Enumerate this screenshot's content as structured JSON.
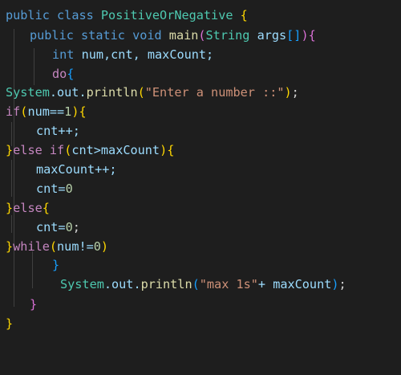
{
  "code": {
    "l1": {
      "kw_public": "public",
      "kw_class": "class",
      "class_name": "PositiveOrNegative",
      "brace": "{"
    },
    "l2": {
      "kw_public": "public",
      "kw_static": "static",
      "kw_void": "void",
      "method": "main",
      "paren_open": "(",
      "type": "String",
      "param": "args",
      "brackets": "[]",
      "paren_close": ")",
      "brace": "{"
    },
    "l3": {
      "kw_int": "int",
      "decl": "num,cnt, maxCount;"
    },
    "l4": {
      "kw_do": "do",
      "brace": "{"
    },
    "l5": {
      "obj": "System",
      "field": ".out.",
      "method": "println",
      "paren_open": "(",
      "str": "\"Enter a number ::\"",
      "paren_close": ")",
      "semi": ";"
    },
    "l6": {
      "kw_if": "if",
      "paren_open": "(",
      "cond": "num==",
      "num": "1",
      "paren_close": ")",
      "brace": "{"
    },
    "l7": {
      "stmt": "cnt++;"
    },
    "l8": {
      "brace_close": "}",
      "kw_else": "else",
      "kw_if": "if",
      "paren_open": "(",
      "cond": "cnt>maxCount",
      "paren_close": ")",
      "brace": "{"
    },
    "l9": {
      "stmt": "maxCount++;"
    },
    "l10": {
      "stmt": "cnt=",
      "num": "0"
    },
    "l11": {
      "brace_close": "}",
      "kw_else": "else",
      "brace": "{"
    },
    "l12": {
      "stmt": "cnt=",
      "num": "0",
      "semi": ";"
    },
    "l13": {
      "brace_close": "}",
      "kw_while": "while",
      "paren_open": "(",
      "cond": "num!=",
      "num": "0",
      "paren_close": ")"
    },
    "l14": {
      "brace": "}"
    },
    "l15": {
      "obj": "System",
      "field": ".out.",
      "method": "println",
      "paren_open": "(",
      "str": "\"max 1s\"",
      "rest": "+ maxCount",
      "paren_close": ")",
      "semi": ";"
    },
    "l16": {
      "brace": "}"
    },
    "l17": {
      "brace": "}"
    }
  },
  "colors": {
    "background": "#1e1e1e",
    "keyword": "#569cd6",
    "control": "#c586c0",
    "type": "#4ec9b0",
    "function": "#dcdcaa",
    "variable": "#9cdcfe",
    "string": "#ce9178",
    "number": "#b5cea8",
    "text": "#d4d4d4"
  }
}
